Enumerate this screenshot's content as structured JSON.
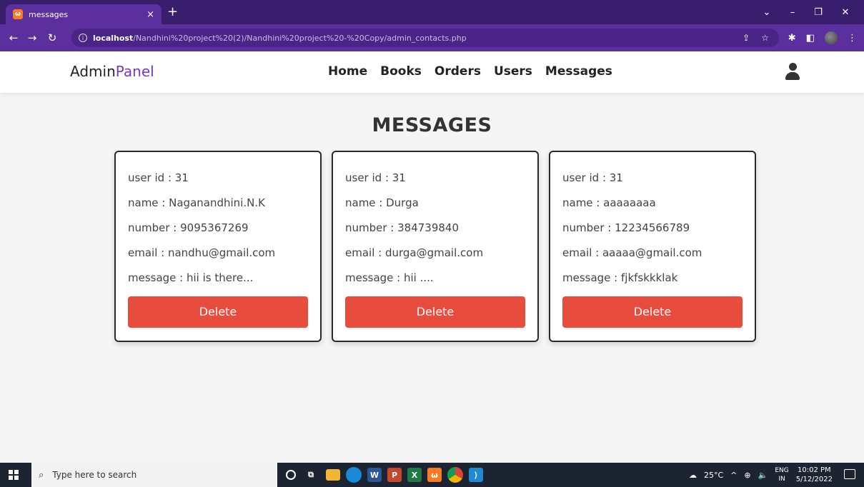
{
  "browser": {
    "tab_title": "messages",
    "tab_close": "×",
    "new_tab": "+",
    "url_host": "localhost",
    "url_path": "/Nandhini%20project%20(2)/Nandhini%20project%20-%20Copy/admin_contacts.php"
  },
  "header": {
    "logo_main": "Admin",
    "logo_accent": "Panel",
    "nav": [
      "Home",
      "Books",
      "Orders",
      "Users",
      "Messages"
    ]
  },
  "main": {
    "title": "MESSAGES",
    "cards": [
      {
        "user_id": "user id : 31",
        "name": "name : Naganandhini.N.K",
        "number": "number : 9095367269",
        "email": "email : nandhu@gmail.com",
        "message": "message : hii is there...",
        "delete_label": "Delete"
      },
      {
        "user_id": "user id : 31",
        "name": "name : Durga",
        "number": "number : 384739840",
        "email": "email : durga@gmail.com",
        "message": "message : hii ....",
        "delete_label": "Delete"
      },
      {
        "user_id": "user id : 31",
        "name": "name : aaaaaaaa",
        "number": "number : 12234566789",
        "email": "email : aaaaa@gmail.com",
        "message": "message : fjkfskkklak",
        "delete_label": "Delete"
      }
    ]
  },
  "taskbar": {
    "search_placeholder": "Type here to search",
    "weather": "25°C",
    "lang_top": "ENG",
    "lang_bottom": "IN",
    "time": "10:02 PM",
    "date": "5/12/2022"
  },
  "colors": {
    "browser_frame": "#5b2f9e",
    "accent": "#7a36c7",
    "delete": "#e74c3c"
  }
}
